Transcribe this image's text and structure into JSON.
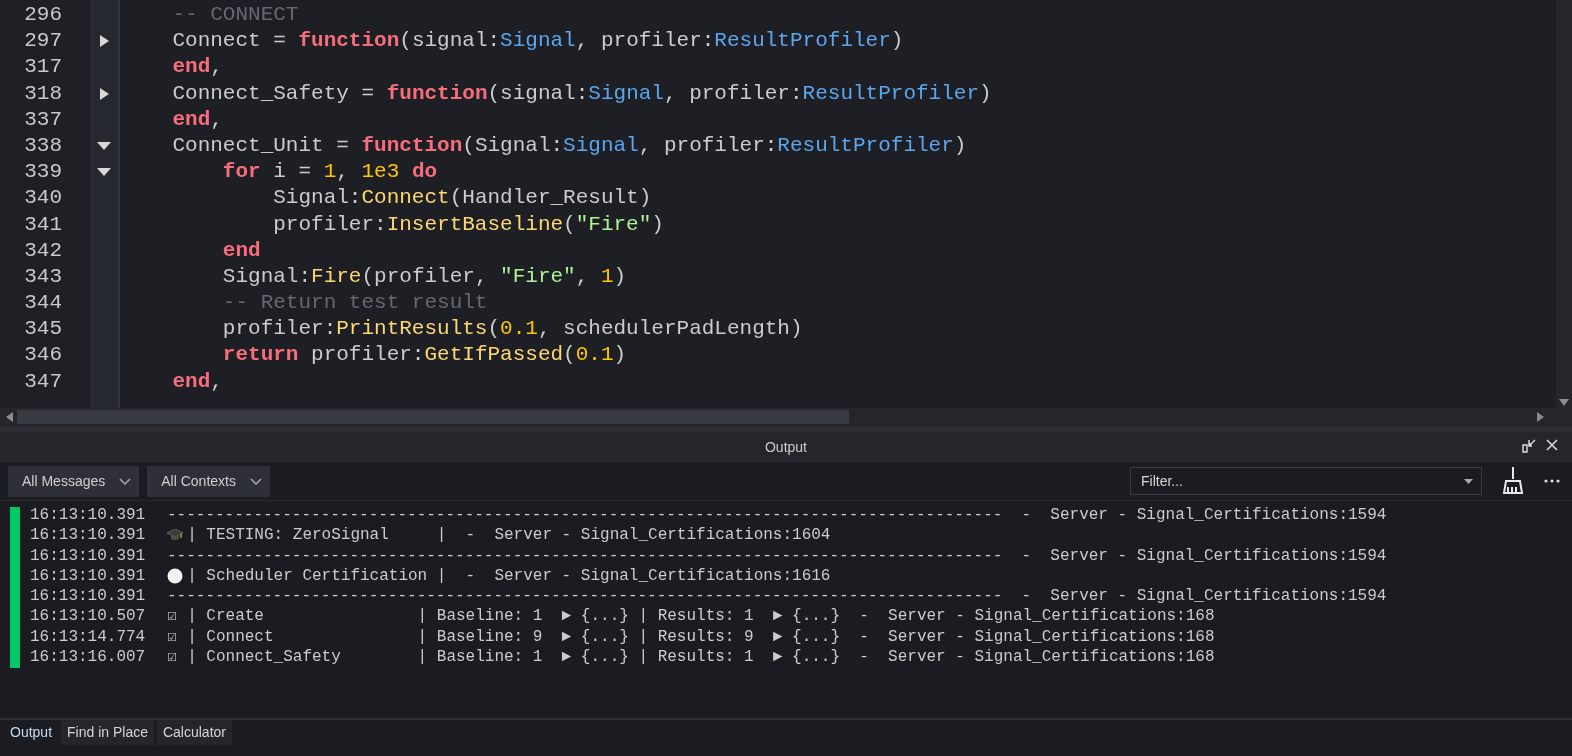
{
  "editor": {
    "lines": [
      {
        "number": "296",
        "tokens": [
          {
            "kind": "comment",
            "text": "    -- CONNECT"
          }
        ]
      },
      {
        "number": "297",
        "expanded": false,
        "tokens": [
          {
            "kind": "plain",
            "text": "    Connect = "
          },
          {
            "kind": "keyword",
            "text": "function"
          },
          {
            "kind": "plain",
            "text": "(signal:"
          },
          {
            "kind": "type",
            "text": "Signal"
          },
          {
            "kind": "plain",
            "text": ", profiler:"
          },
          {
            "kind": "type",
            "text": "ResultProfiler"
          },
          {
            "kind": "plain",
            "text": ")"
          }
        ]
      },
      {
        "number": "317",
        "tokens": [
          {
            "kind": "keyword",
            "text": "    end"
          },
          {
            "kind": "plain",
            "text": ","
          }
        ]
      },
      {
        "number": "318",
        "expanded": false,
        "tokens": [
          {
            "kind": "plain",
            "text": "    Connect_Safety = "
          },
          {
            "kind": "keyword",
            "text": "function"
          },
          {
            "kind": "plain",
            "text": "(signal:"
          },
          {
            "kind": "type",
            "text": "Signal"
          },
          {
            "kind": "plain",
            "text": ", profiler:"
          },
          {
            "kind": "type",
            "text": "ResultProfiler"
          },
          {
            "kind": "plain",
            "text": ")"
          }
        ]
      },
      {
        "number": "337",
        "tokens": [
          {
            "kind": "keyword",
            "text": "    end"
          },
          {
            "kind": "plain",
            "text": ","
          }
        ]
      },
      {
        "number": "338",
        "expanded": true,
        "tokens": [
          {
            "kind": "plain",
            "text": "    Connect_Unit = "
          },
          {
            "kind": "keyword",
            "text": "function"
          },
          {
            "kind": "plain",
            "text": "(Signal:"
          },
          {
            "kind": "type",
            "text": "Signal"
          },
          {
            "kind": "plain",
            "text": ", profiler:"
          },
          {
            "kind": "type",
            "text": "ResultProfiler"
          },
          {
            "kind": "plain",
            "text": ")"
          }
        ]
      },
      {
        "number": "339",
        "expanded": true,
        "tokens": [
          {
            "kind": "keyword",
            "text": "        for"
          },
          {
            "kind": "plain",
            "text": " i = "
          },
          {
            "kind": "number",
            "text": "1"
          },
          {
            "kind": "plain",
            "text": ", "
          },
          {
            "kind": "number",
            "text": "1e3"
          },
          {
            "kind": "keyword",
            "text": " do"
          }
        ]
      },
      {
        "number": "340",
        "tokens": [
          {
            "kind": "plain",
            "text": "            Signal:"
          },
          {
            "kind": "method",
            "text": "Connect"
          },
          {
            "kind": "plain",
            "text": "(Handler_Result)"
          }
        ]
      },
      {
        "number": "341",
        "tokens": [
          {
            "kind": "plain",
            "text": "            profiler:"
          },
          {
            "kind": "method",
            "text": "InsertBaseline"
          },
          {
            "kind": "plain",
            "text": "("
          },
          {
            "kind": "string",
            "text": "\"Fire\""
          },
          {
            "kind": "plain",
            "text": ")"
          }
        ]
      },
      {
        "number": "342",
        "tokens": [
          {
            "kind": "keyword",
            "text": "        end"
          }
        ]
      },
      {
        "number": "343",
        "tokens": [
          {
            "kind": "plain",
            "text": "        Signal:"
          },
          {
            "kind": "method",
            "text": "Fire"
          },
          {
            "kind": "plain",
            "text": "(profiler, "
          },
          {
            "kind": "string",
            "text": "\"Fire\""
          },
          {
            "kind": "plain",
            "text": ", "
          },
          {
            "kind": "number",
            "text": "1"
          },
          {
            "kind": "plain",
            "text": ")"
          }
        ]
      },
      {
        "number": "344",
        "tokens": [
          {
            "kind": "comment",
            "text": "        -- Return test result"
          }
        ]
      },
      {
        "number": "345",
        "tokens": [
          {
            "kind": "plain",
            "text": "        profiler:"
          },
          {
            "kind": "method",
            "text": "PrintResults"
          },
          {
            "kind": "plain",
            "text": "("
          },
          {
            "kind": "number",
            "text": "0.1"
          },
          {
            "kind": "plain",
            "text": ", schedulerPadLength)"
          }
        ]
      },
      {
        "number": "346",
        "tokens": [
          {
            "kind": "keyword",
            "text": "        return"
          },
          {
            "kind": "plain",
            "text": " profiler:"
          },
          {
            "kind": "method",
            "text": "GetIfPassed"
          },
          {
            "kind": "plain",
            "text": "("
          },
          {
            "kind": "number",
            "text": "0.1"
          },
          {
            "kind": "plain",
            "text": ")"
          }
        ]
      },
      {
        "number": "347",
        "tokens": [
          {
            "kind": "keyword",
            "text": "    end"
          },
          {
            "kind": "plain",
            "text": ","
          }
        ]
      }
    ]
  },
  "output": {
    "title": "Output",
    "message_filter": "All Messages",
    "context_filter": "All Contexts",
    "filter": {
      "placeholder": "Filter..."
    },
    "log": [
      {
        "time": "16:13:10.391",
        "kind": "divider",
        "text": "---------------------------------------------------------------------------------------  -  Server - Signal_Certifications:1594"
      },
      {
        "time": "16:13:10.391",
        "kind": "cap",
        "text": "| TESTING: ZeroSignal     |  -  Server - Signal_Certifications:1604"
      },
      {
        "time": "16:13:10.391",
        "kind": "divider",
        "text": "---------------------------------------------------------------------------------------  -  Server - Signal_Certifications:1594"
      },
      {
        "time": "16:13:10.391",
        "kind": "circle",
        "text": "| Scheduler Certification |  -  Server - Signal_Certifications:1616"
      },
      {
        "time": "16:13:10.391",
        "kind": "divider",
        "text": "---------------------------------------------------------------------------------------  -  Server - Signal_Certifications:1594"
      },
      {
        "time": "16:13:10.507",
        "kind": "check",
        "mark": "☑",
        "text": "| Create                | Baseline: 1  ► {...} | Results: 1  ► {...}  -  Server - Signal_Certifications:168"
      },
      {
        "time": "16:13:14.774",
        "kind": "check",
        "mark": "☑",
        "text": "| Connect               | Baseline: 9  ► {...} | Results: 9  ► {...}  -  Server - Signal_Certifications:168"
      },
      {
        "time": "16:13:16.007",
        "kind": "check",
        "mark": "☑",
        "text": "| Connect_Safety        | Baseline: 1  ► {...} | Results: 1  ► {...}  -  Server - Signal_Certifications:168"
      }
    ]
  },
  "tabs": [
    {
      "label": "Output",
      "selected": true
    },
    {
      "label": "Find in Place",
      "selected": false
    },
    {
      "label": "Calculator",
      "selected": false
    }
  ]
}
